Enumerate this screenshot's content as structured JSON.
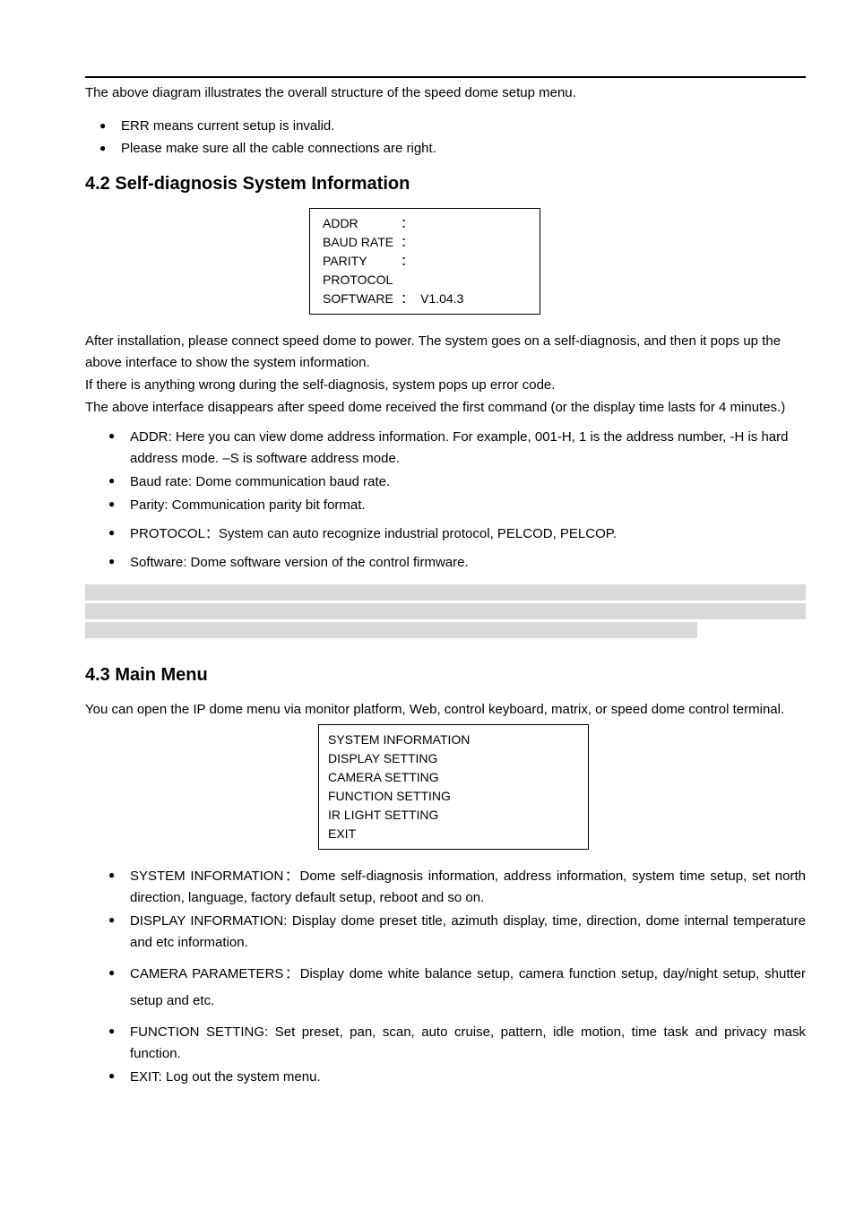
{
  "intro": "The above diagram illustrates the overall structure of the speed dome setup menu.",
  "top_bullets": [
    "ERR means current setup is invalid.",
    "Please make sure all the cable connections are right."
  ],
  "section_42": {
    "heading": "4.2  Self-diagnosis System Information",
    "panel": {
      "rows": [
        {
          "label": "ADDR",
          "sep": "：",
          "value": ""
        },
        {
          "label": "BAUD RATE",
          "sep": "：",
          "value": ""
        },
        {
          "label": "PARITY",
          "sep": "：",
          "value": ""
        },
        {
          "label": "PROTOCOL",
          "sep": "",
          "value": ""
        },
        {
          "label": "SOFTWARE",
          "sep": "：",
          "value": "V1.04.3"
        }
      ]
    },
    "body1": "After installation, please connect speed dome to power. The system goes on a self-diagnosis, and then it pops up the above interface to show the system information.",
    "body2": "If there is anything wrong during the self-diagnosis, system pops up error code.",
    "body3": "The above interface disappears after speed dome received the first command (or the display time lasts for 4 minutes.)",
    "bullets": [
      "ADDR: Here you can view dome address information. For example, 001-H, 1 is the address number, -H is hard address mode. –S is software address mode.",
      "Baud rate: Dome communication baud rate.",
      "Parity: Communication parity bit format.",
      "PROTOCOL：System can auto recognize industrial protocol, PELCOD, PELCOP.",
      "Software: Dome software version of the control firmware."
    ]
  },
  "section_43": {
    "heading": "4.3  Main Menu",
    "body": "You can open the IP dome menu via monitor platform, Web, control keyboard, matrix, or speed dome control terminal.",
    "panel_items": [
      "SYSTEM INFORMATION",
      "DISPLAY SETTING",
      "CAMERA SETTING",
      "FUNCTION SETTING",
      "IR LIGHT SETTING",
      "EXIT"
    ],
    "bullets": [
      "SYSTEM  INFORMATION：Dome self-diagnosis information, address information, system time setup, set north direction, language, factory default setup, reboot and so on.",
      "DISPLAY INFORMATION: Display dome preset title, azimuth display, time, direction, dome internal temperature and etc information.",
      "CAMERA  PARAMETERS：Display dome white balance setup, camera function setup, day/night setup, shutter setup and etc.",
      "FUNCTION SETTING: Set preset, pan, scan, auto cruise, pattern, idle motion, time task and privacy mask function.",
      "EXIT: Log out the system menu."
    ]
  }
}
